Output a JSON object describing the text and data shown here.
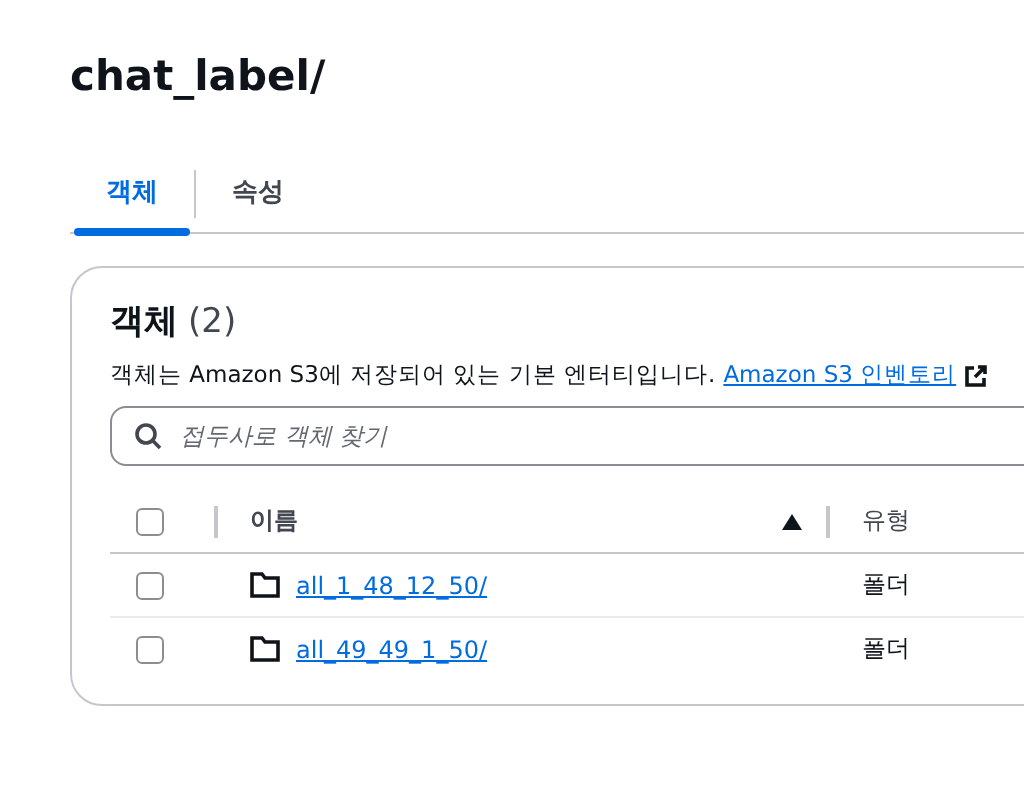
{
  "title": "chat_label/",
  "tabs": [
    {
      "label": "객체",
      "selected": true
    },
    {
      "label": "속성",
      "selected": false
    }
  ],
  "panel": {
    "heading": "객체",
    "count": "(2)",
    "description": "객체는 Amazon S3에 저장되어 있는 기본 엔터티입니다.",
    "link": "Amazon S3 인벤토리",
    "search": {
      "placeholder": "접두사로 객체 찾기"
    },
    "table": {
      "select_all_checked": false,
      "columns": [
        {
          "label": "이름",
          "sorted": true
        },
        {
          "label": "유형"
        }
      ],
      "rows": [
        {
          "name": "all_1_48_12_50/",
          "type": "폴더",
          "checked": false
        },
        {
          "name": "all_49_49_1_50/",
          "type": "폴더",
          "checked": false
        }
      ]
    }
  }
}
